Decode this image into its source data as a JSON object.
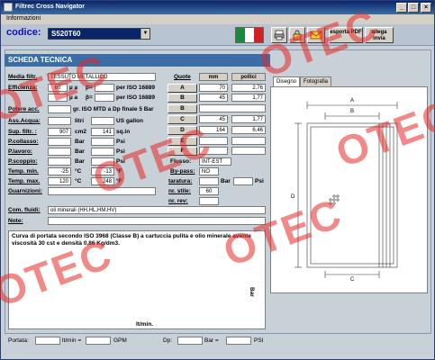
{
  "window": {
    "title": "Filtrec Cross Navigator"
  },
  "menu": {
    "informazioni": "Informazioni"
  },
  "toolbar": {
    "codice_label": "codice:",
    "codice_value": "S520T60",
    "esporta_label": "esporta PDF",
    "allega_label": "allega invia"
  },
  "scheda": {
    "title": "SCHEDA TECNICA",
    "media_label": "Media filtr.",
    "media_value": "TESSUTO METALLICO",
    "efficienza_label": "Efficienza:",
    "eff_val1": "60",
    "eff_a": "µ  a",
    "eff_beta": "β=",
    "eff_iso1": "per ISO 16889",
    "eff_a2": "µ  a",
    "eff_beta2": "β=",
    "eff_iso2": "per ISO 16889",
    "potere_label": "Potere acc.",
    "potere_text": "gr. ISO MTD a Dp finale 5 Bar",
    "ass_label": "Ass.Acqua:",
    "ass_litri": "litri",
    "ass_us": "US gallon",
    "sup_label": "Sup. filtr. :",
    "sup_val": "907",
    "sup_cm2": "cm2",
    "sup_val2": "141",
    "sup_sqin": "sq.in",
    "pcollasso_label": "P.collasso:",
    "pcollasso_bar": "Bar",
    "pcollasso_psi": "Psi",
    "plavoro_label": "P.lavoro:",
    "plavoro_bar": "Bar",
    "plavoro_psi": "Psi",
    "pscoppio_label": "P.scoppio:",
    "pscoppio_bar": "Bar",
    "pscoppio_psi": "Psi",
    "tmin_label": "Temp. min.",
    "tmin_c": "-25",
    "tmin_cu": "°C",
    "tmin_f": "-13",
    "tmin_fu": "°F",
    "tmax_label": "Temp. max.",
    "tmax_c": "120",
    "tmax_cu": "°C",
    "tmax_f": "248",
    "tmax_fu": "°F",
    "guarnizioni_label": "Guarnizioni:",
    "comfluidi_label": "Com. fluidi:",
    "comfluidi_value": "oli minerali (HH,HL,HM,HV)",
    "note_label": "Note:"
  },
  "quote": {
    "header_quote": "Quote",
    "header_mm": "mm",
    "header_pollici": "pollici",
    "rows": [
      {
        "label": "A",
        "mm": "70",
        "in": "2,76"
      },
      {
        "label": "B",
        "mm": "45",
        "in": "1,77"
      },
      {
        "label": "B",
        "mm": "",
        "in": ""
      },
      {
        "label": "C",
        "mm": "45",
        "in": "1,77"
      },
      {
        "label": "D",
        "mm": "164",
        "in": "6,46"
      },
      {
        "label": "E",
        "mm": "",
        "in": ""
      },
      {
        "label": "F",
        "mm": "",
        "in": ""
      }
    ],
    "flusso_label": "Flusso:",
    "flusso_value": "INT-EST",
    "bypass_label": "By-pass:",
    "bypass_value": "NO",
    "taratura_label": "taratura:",
    "taratura_bar": "Bar",
    "taratura_psi": "Psi",
    "nrstile_label": "nr. stile:",
    "nrstile_value": "60",
    "nrrev_label": "nr. rev:"
  },
  "tabs": {
    "disegno": "Disegno",
    "fotografia": "Fotografia"
  },
  "drawing": {
    "a": "A",
    "b": "B",
    "c": "C",
    "d": "D"
  },
  "graph": {
    "description": "Curva di portata secondo ISO 3968 (Classe B) a cartuccia pulita e olio minerale avente viscosità 30 cst e densità 0,86 Kg/dm3.",
    "yaxis": "Bar",
    "xaxis": "lt/min."
  },
  "status": {
    "portata_label": "Portata:",
    "ltmin": "lt/min =",
    "gpm": "GPM",
    "dp_label": "Dp:",
    "bar_eq": "Bar  =",
    "psi": "PSI"
  },
  "watermark": "OTEC",
  "colors": {
    "accent": "#3a6ea5",
    "watermark": "#e62828",
    "codice": "#1010c0"
  }
}
